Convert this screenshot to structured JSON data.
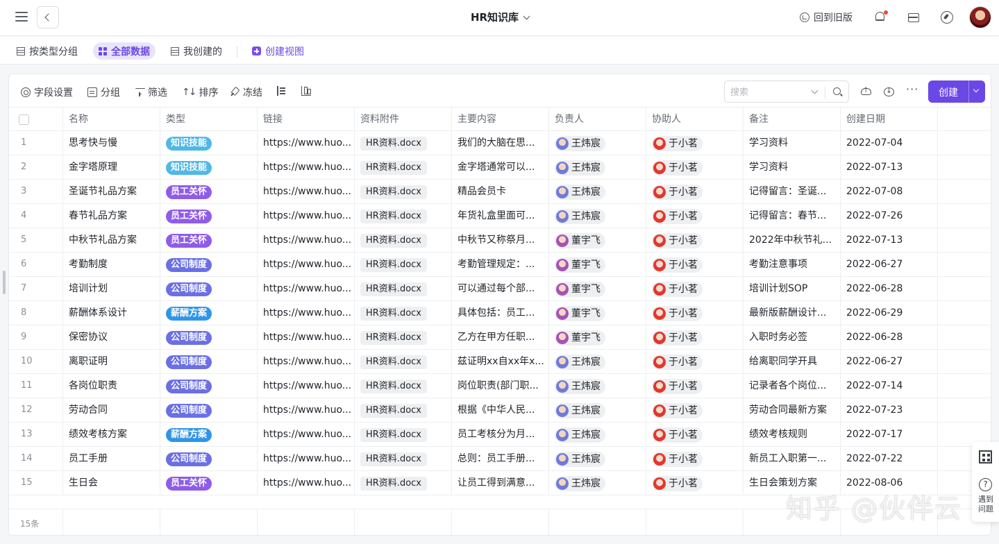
{
  "app": {
    "title": "HR知识库",
    "back_old_label": "回到旧版"
  },
  "views": {
    "tabs": [
      {
        "label": "按类型分组",
        "active": false
      },
      {
        "label": "全部数据",
        "active": true
      },
      {
        "label": "我创建的",
        "active": false
      }
    ],
    "create_label": "创建视图"
  },
  "toolbar": {
    "field_settings": "字段设置",
    "group": "分组",
    "filter": "筛选",
    "sort": "排序",
    "freeze": "冻结",
    "search_placeholder": "搜索",
    "create_label": "创建"
  },
  "table": {
    "columns": [
      "名称",
      "类型",
      "链接",
      "资料附件",
      "主要内容",
      "负责人",
      "协助人",
      "备注",
      "创建日期"
    ],
    "rows": [
      {
        "idx": "1",
        "name": "思考快与慢",
        "type": "知识技能",
        "link": "https://www.huo...",
        "file": "HR资料.docx",
        "content": "我们的大脑在思...",
        "owner": "王炜宸",
        "helper": "于小茗",
        "note": "学习资料",
        "date": "2022-07-04"
      },
      {
        "idx": "2",
        "name": "金字塔原理",
        "type": "知识技能",
        "link": "https://www.huo...",
        "file": "HR资料.docx",
        "content": "金字塔通常可以...",
        "owner": "王炜宸",
        "helper": "于小茗",
        "note": "学习资料",
        "date": "2022-07-13"
      },
      {
        "idx": "3",
        "name": "圣诞节礼品方案",
        "type": "员工关怀",
        "link": "https://www.huo...",
        "file": "HR资料.docx",
        "content": "精品会员卡",
        "owner": "王炜宸",
        "helper": "于小茗",
        "note": "记得留言：圣诞...",
        "date": "2022-07-08"
      },
      {
        "idx": "4",
        "name": "春节礼品方案",
        "type": "员工关怀",
        "link": "https://www.huo...",
        "file": "HR资料.docx",
        "content": "年货礼盒里面可...",
        "owner": "王炜宸",
        "helper": "于小茗",
        "note": "记得留言：春节...",
        "date": "2022-07-26"
      },
      {
        "idx": "5",
        "name": "中秋节礼品方案",
        "type": "员工关怀",
        "link": "https://www.huo...",
        "file": "HR资料.docx",
        "content": "中秋节又称祭月...",
        "owner": "董宇飞",
        "helper": "于小茗",
        "note": "2022年中秋节礼...",
        "date": "2022-07-13"
      },
      {
        "idx": "6",
        "name": "考勤制度",
        "type": "公司制度",
        "link": "https://www.huo...",
        "file": "HR资料.docx",
        "content": "考勤管理规定：...",
        "owner": "董宇飞",
        "helper": "于小茗",
        "note": "考勤注意事项",
        "date": "2022-06-27"
      },
      {
        "idx": "7",
        "name": "培训计划",
        "type": "公司制度",
        "link": "https://www.huo...",
        "file": "HR资料.docx",
        "content": "可以通过每个部...",
        "owner": "董宇飞",
        "helper": "于小茗",
        "note": "培训计划SOP",
        "date": "2022-06-28"
      },
      {
        "idx": "8",
        "name": "薪酬体系设计",
        "type": "薪酬方案",
        "link": "https://www.huo...",
        "file": "HR资料.docx",
        "content": "具体包括：员工...",
        "owner": "董宇飞",
        "helper": "于小茗",
        "note": "最新版薪酬设计...",
        "date": "2022-06-29"
      },
      {
        "idx": "9",
        "name": "保密协议",
        "type": "公司制度",
        "link": "https://www.huo...",
        "file": "HR资料.docx",
        "content": "乙方在甲方任职...",
        "owner": "董宇飞",
        "helper": "于小茗",
        "note": "入职时务必签",
        "date": "2022-06-28"
      },
      {
        "idx": "10",
        "name": "离职证明",
        "type": "公司制度",
        "link": "https://www.huo...",
        "file": "HR资料.docx",
        "content": "兹证明xx自xx年x...",
        "owner": "王炜宸",
        "helper": "于小茗",
        "note": "给离职同学开具",
        "date": "2022-06-27"
      },
      {
        "idx": "11",
        "name": "各岗位职责",
        "type": "公司制度",
        "link": "https://www.huo...",
        "file": "HR资料.docx",
        "content": "岗位职责(部门职...",
        "owner": "王炜宸",
        "helper": "于小茗",
        "note": "记录者各个岗位...",
        "date": "2022-07-14"
      },
      {
        "idx": "12",
        "name": "劳动合同",
        "type": "公司制度",
        "link": "https://www.huo...",
        "file": "HR资料.docx",
        "content": "根据《中华人民...",
        "owner": "王炜宸",
        "helper": "于小茗",
        "note": "劳动合同最新方案",
        "date": "2022-07-23"
      },
      {
        "idx": "13",
        "name": "绩效考核方案",
        "type": "薪酬方案",
        "link": "https://www.huo...",
        "file": "HR资料.docx",
        "content": "员工考核分为月...",
        "owner": "王炜宸",
        "helper": "于小茗",
        "note": "绩效考核规则",
        "date": "2022-07-17"
      },
      {
        "idx": "14",
        "name": "员工手册",
        "type": "公司制度",
        "link": "https://www.huo...",
        "file": "HR资料.docx",
        "content": "总则：员工手册...",
        "owner": "王炜宸",
        "helper": "于小茗",
        "note": "新员工入职第一...",
        "date": "2022-07-22"
      },
      {
        "idx": "15",
        "name": "生日会",
        "type": "员工关怀",
        "link": "https://www.huo...",
        "file": "HR资料.docx",
        "content": "让员工得到满意...",
        "owner": "王炜宸",
        "helper": "于小茗",
        "note": "生日会策划方案",
        "date": "2022-08-06"
      }
    ],
    "footer_count": "15条"
  },
  "tag_colors": {
    "知识技能": "#4fb8e6",
    "员工关怀": "#8f5ce8",
    "公司制度": "#6b6fe6",
    "薪酬方案": "#2e95e8"
  },
  "side_widget": {
    "help_label": "遇到问题",
    "help_glyph": "?"
  },
  "watermark": "知乎 @伙伴云"
}
